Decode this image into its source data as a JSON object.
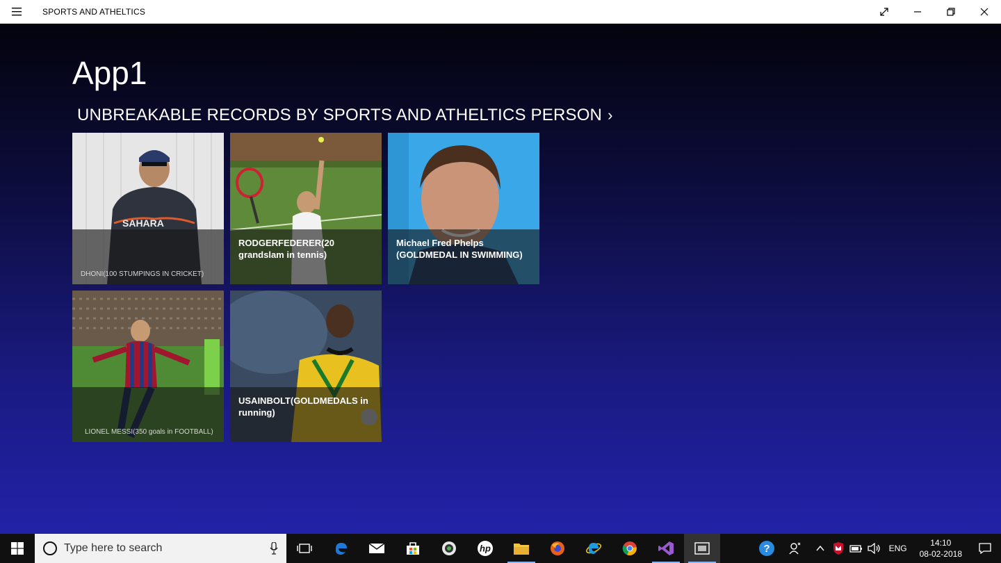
{
  "window": {
    "title": "SPORTS AND ATHELTICS"
  },
  "page": {
    "title": "App1",
    "section_header": "UNBREAKABLE RECORDS BY SPORTS AND ATHELTICS PERSON",
    "chevron": "›"
  },
  "tiles": [
    {
      "caption": "DHONI(100 STUMPINGS IN CRICKET)"
    },
    {
      "caption": "RODGERFEDERER(20 grandslam in tennis)"
    },
    {
      "caption": "Michael Fred Phelps (GOLDMEDAL IN SWIMMING)"
    },
    {
      "caption": "LIONEL MESSI(350 goals in FOOTBALL)"
    },
    {
      "caption": "USAINBOLT(GOLDMEDALS in running)"
    }
  ],
  "taskbar": {
    "search_placeholder": "Type here to search",
    "language": "ENG",
    "time": "14:10",
    "date": "08-02-2018"
  },
  "colors": {
    "accent": "#1e6fd9",
    "phelps_bg": "#3aa8e8"
  }
}
